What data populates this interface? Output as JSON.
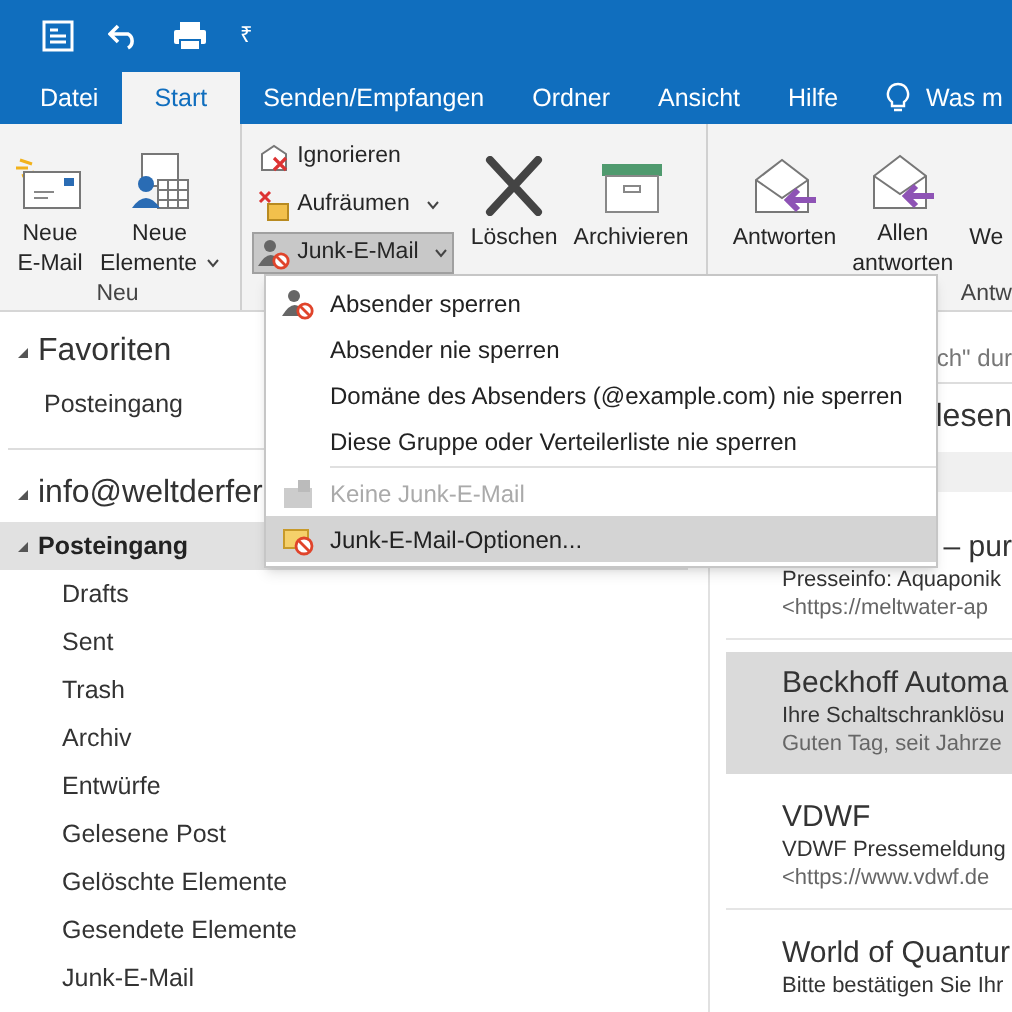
{
  "quick_access": {
    "more": "₹"
  },
  "tabs": [
    {
      "label": "Datei",
      "selected": false
    },
    {
      "label": "Start",
      "selected": true
    },
    {
      "label": "Senden/Empfangen",
      "selected": false
    },
    {
      "label": "Ordner",
      "selected": false
    },
    {
      "label": "Ansicht",
      "selected": false
    },
    {
      "label": "Hilfe",
      "selected": false
    }
  ],
  "tell_me": "Was m",
  "ribbon": {
    "groups": [
      {
        "label": "Neu",
        "buttons": [
          {
            "kind": "new-mail",
            "label": "Neue E-Mail",
            "dropdown": false
          },
          {
            "kind": "new-items",
            "label": "Neue Elemente",
            "dropdown": true
          }
        ]
      },
      {
        "small_buttons": [
          {
            "kind": "ignore",
            "label": "Ignorieren",
            "dropdown": false,
            "pressed": false
          },
          {
            "kind": "cleanup",
            "label": "Aufräumen",
            "dropdown": true,
            "pressed": false
          },
          {
            "kind": "junk",
            "label": "Junk-E-Mail",
            "dropdown": true,
            "pressed": true
          }
        ],
        "buttons": [
          {
            "kind": "delete",
            "label": "Löschen",
            "dropdown": false
          },
          {
            "kind": "archive",
            "label": "Archivieren",
            "dropdown": false
          }
        ]
      },
      {
        "label": "Antw",
        "buttons": [
          {
            "kind": "reply",
            "label": "Antworten",
            "dropdown": false
          },
          {
            "kind": "reply-all",
            "label": "Allen antworten",
            "dropdown": false
          },
          {
            "kind": "forward",
            "label": "We",
            "dropdown": false
          }
        ]
      }
    ]
  },
  "junk_menu": [
    {
      "kind": "block",
      "label": "Absender sperren",
      "disabled": false,
      "selected": false
    },
    {
      "kind": "plain",
      "label": "Absender nie sperren",
      "disabled": false,
      "selected": false
    },
    {
      "kind": "plain",
      "label": "Domäne des Absenders (@example.com) nie sperren",
      "disabled": false,
      "selected": false
    },
    {
      "kind": "plain",
      "label": "Diese Gruppe oder Verteilerliste nie sperren",
      "disabled": false,
      "selected": false
    },
    {
      "kind": "not-junk",
      "label": "Keine Junk-E-Mail",
      "disabled": true,
      "selected": false
    },
    {
      "kind": "options",
      "label": "Junk-E-Mail-Optionen...",
      "disabled": false,
      "selected": true
    }
  ],
  "folder_pane": {
    "favorites": {
      "label": "Favoriten",
      "expanded": true,
      "items": [
        "Posteingang"
      ]
    },
    "account": {
      "label": "info@weltderfer",
      "expanded": true,
      "folders": [
        {
          "label": "Posteingang",
          "selected": true,
          "expanded": true,
          "children": [
            {
              "label": "Drafts"
            },
            {
              "label": "Sent"
            },
            {
              "label": "Trash"
            },
            {
              "label": "Archiv"
            },
            {
              "label": "Entwürfe"
            },
            {
              "label": "Gelesene Post"
            },
            {
              "label": "Gelöschte Elemente"
            },
            {
              "label": "Gesendete Elemente"
            },
            {
              "label": "Junk-E-Mail"
            }
          ]
        }
      ]
    }
  },
  "message_list": {
    "search_placeholder": "ch\" dur",
    "filter_tab": "lesen",
    "messages": [
      {
        "sender": "– pur",
        "subject": "Presseinfo: Aquaponik",
        "preview": "<https://meltwater-ap",
        "selected": false
      },
      {
        "sender": "Beckhoff Automa",
        "subject": "Ihre Schaltschranklösu",
        "preview": "Guten Tag, seit Jahrze",
        "selected": true
      },
      {
        "sender": "VDWF",
        "subject": "VDWF Pressemeldung",
        "preview": "<https://www.vdwf.de",
        "selected": false
      },
      {
        "sender": "World of Quantur",
        "subject": "Bitte bestätigen Sie Ihr",
        "selected": false
      }
    ]
  }
}
